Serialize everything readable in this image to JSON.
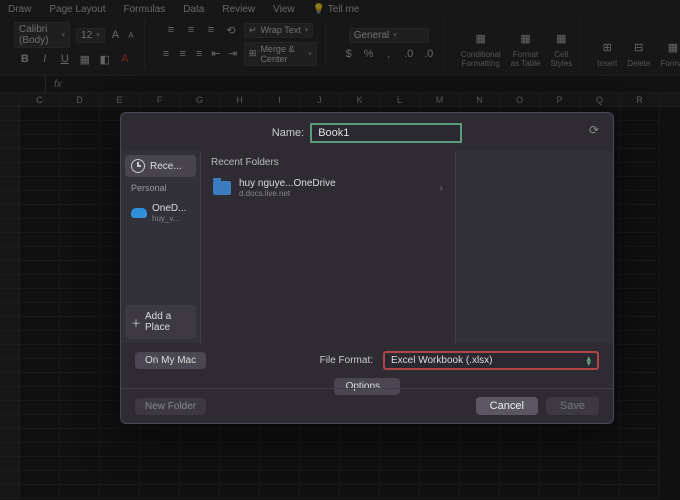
{
  "ribbon": {
    "tabs": [
      "Draw",
      "Page Layout",
      "Formulas",
      "Data",
      "Review",
      "View",
      "Tell me"
    ],
    "font_name": "Calibri (Body)",
    "font_size": "12",
    "wrap": "Wrap Text",
    "merge": "Merge & Center",
    "number_format": "General",
    "cond_fmt": "Conditional\nFormatting",
    "fmt_table": "Format\nas Table",
    "cell_styles": "Cell\nStyles",
    "insert": "Insert",
    "delete": "Delete",
    "format": "Format"
  },
  "columns": [
    "",
    "C",
    "D",
    "E",
    "F",
    "G",
    "H",
    "I",
    "J",
    "K",
    "L",
    "M",
    "N",
    "O",
    "P",
    "Q",
    "R"
  ],
  "dialog": {
    "name_label": "Name:",
    "name_value": "Book1",
    "sidebar": {
      "recent": "Rece...",
      "personal": "Personal",
      "onedrive": "OneD...",
      "onedrive_sub": "huy_v...",
      "add_place": "Add a Place"
    },
    "recent_folders_hdr": "Recent Folders",
    "folder": {
      "name": "huy nguye...OneDrive",
      "sub": "d.docs.live.net"
    },
    "on_my_mac": "On My Mac",
    "file_format_label": "File Format:",
    "file_format_value": "Excel Workbook (.xlsx)",
    "options": "Options...",
    "new_folder": "New Folder",
    "cancel": "Cancel",
    "save": "Save"
  }
}
